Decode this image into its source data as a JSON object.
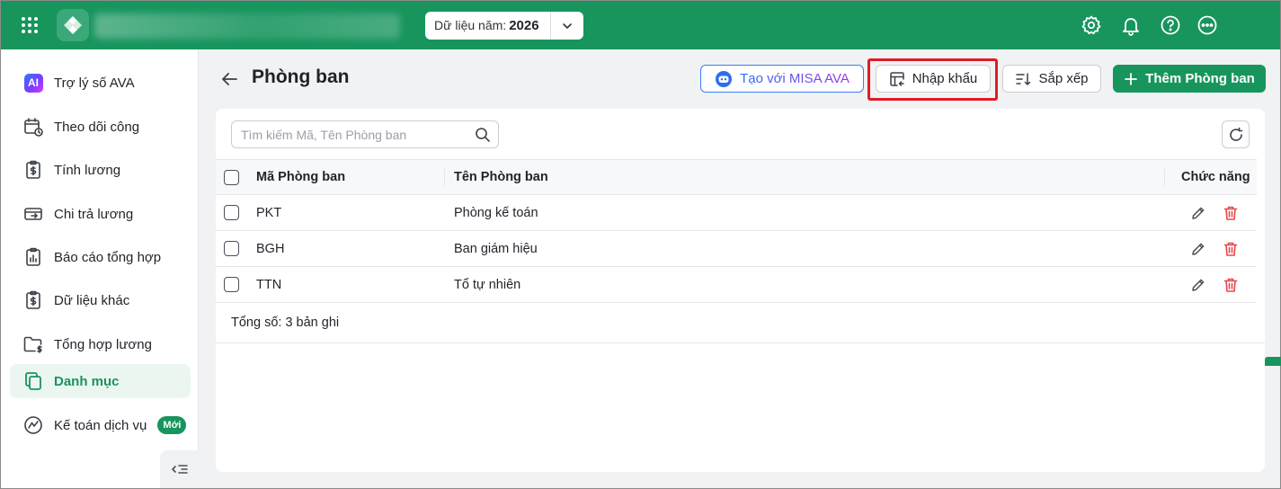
{
  "topbar": {
    "year_label": "Dữ liệu năm:",
    "year_value": "2026",
    "colors": {
      "background": "#17955d"
    }
  },
  "sidebar": {
    "items": [
      {
        "label": "Trợ lý số AVA",
        "icon": "ai-assistant-icon",
        "badge_text": "AI"
      },
      {
        "label": "Theo dõi công",
        "icon": "calendar-clock-icon"
      },
      {
        "label": "Tính lương",
        "icon": "clipboard-dollar-icon"
      },
      {
        "label": "Chi trả lương",
        "icon": "money-transfer-icon"
      },
      {
        "label": "Báo cáo tổng hợp",
        "icon": "report-chart-icon"
      },
      {
        "label": "Dữ liệu khác",
        "icon": "clipboard-data-icon"
      },
      {
        "label": "Tổng hợp lương",
        "icon": "folder-dollar-icon"
      },
      {
        "label": "Danh mục",
        "icon": "copy-pages-icon",
        "active": true
      },
      {
        "label": "Kế toán dịch vụ",
        "icon": "chart-circle-icon",
        "badge": "Mới"
      }
    ]
  },
  "header": {
    "title": "Phòng ban",
    "buttons": {
      "ava": "Tạo với MISA AVA",
      "import": "Nhập khẩu",
      "sort": "Sắp xếp",
      "add": "Thêm Phòng ban"
    }
  },
  "search": {
    "placeholder": "Tìm kiếm Mã, Tên Phòng ban",
    "value": ""
  },
  "table": {
    "columns": {
      "code": "Mã Phòng ban",
      "name": "Tên Phòng ban",
      "actions": "Chức năng"
    },
    "rows": [
      {
        "code": "PKT",
        "name": "Phòng kế toán"
      },
      {
        "code": "BGH",
        "name": "Ban giám hiệu"
      },
      {
        "code": "TTN",
        "name": "Tổ tự nhiên"
      }
    ],
    "total": "Tổng số: 3 bản ghi"
  },
  "colors": {
    "brand": "#17955d",
    "danger": "#e5484d",
    "highlight": "#e01b23"
  }
}
